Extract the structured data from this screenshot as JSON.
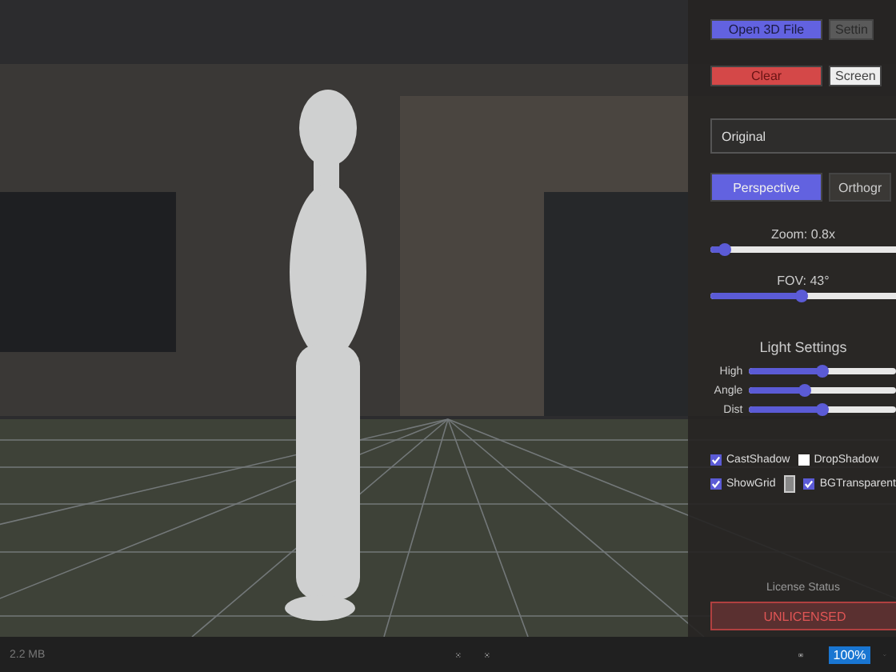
{
  "panel": {
    "button_rows": [
      [
        {
          "label": "Open 3D File",
          "kind": "primary"
        },
        {
          "label": "Settin",
          "kind": "neutral"
        }
      ],
      [
        {
          "label": "Clear",
          "kind": "danger"
        },
        {
          "label": "Screen",
          "kind": "light"
        }
      ]
    ],
    "dropdown": {
      "value": "Original"
    },
    "projection_tabs": [
      {
        "label": "Perspective",
        "selected": true
      },
      {
        "label": "Orthogr",
        "selected": false
      }
    ],
    "zoom": {
      "label": "Zoom: 0.8x",
      "level": 0.07
    },
    "fov": {
      "label": "FOV: 43°",
      "level": 0.45
    },
    "light_settings": {
      "title": "Light Settings",
      "sliders": [
        {
          "label": "High",
          "level": 0.5
        },
        {
          "label": "Angle",
          "level": 0.38
        },
        {
          "label": "Dist",
          "level": 0.5
        }
      ]
    },
    "option_rows": [
      [
        {
          "kind": "checkbox",
          "label": "CastShadow",
          "checked": true
        },
        {
          "kind": "checkbox",
          "label": "DropShadow",
          "checked": false
        }
      ],
      [
        {
          "kind": "checkbox",
          "label": "ShowGrid",
          "checked": true
        },
        {
          "kind": "swatch"
        },
        {
          "kind": "checkbox",
          "label": "BGTransparent",
          "checked": true
        }
      ]
    ],
    "license": {
      "label": "License Status",
      "status": "UNLICENSED"
    }
  },
  "status_bar": {
    "file_size": "2.2 MB",
    "zoom": "100%"
  }
}
